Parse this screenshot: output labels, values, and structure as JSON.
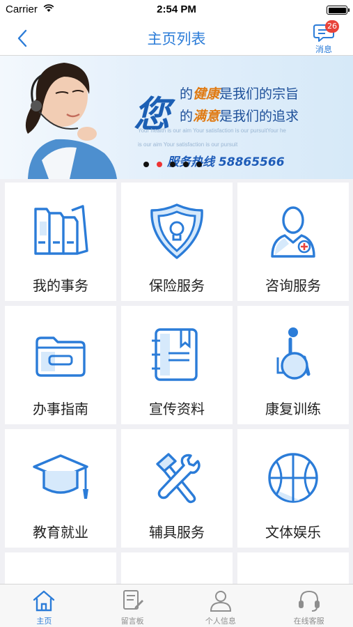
{
  "status_bar": {
    "carrier": "Carrier",
    "time": "2:54 PM"
  },
  "nav": {
    "title": "主页列表",
    "messages_label": "消息",
    "messages_badge": "26"
  },
  "banner": {
    "big_char": "您",
    "line1_a": "的",
    "line1_hl": "健康",
    "line1_b": "是我们的宗旨",
    "line2_a": "的",
    "line2_hl": "满意",
    "line2_b": "是我们的追求",
    "subtitle_1": "Your health is our aim  Your satisfaction is our pursuitYour he",
    "subtitle_2": "is our aim  Your satisfaction is our pursuit",
    "hotline": "服务热线 58865566",
    "active_dot": 1,
    "dot_count": 5
  },
  "menu": [
    {
      "label": "我的事务",
      "icon": "folders-icon"
    },
    {
      "label": "保险服务",
      "icon": "shield-bulb-icon"
    },
    {
      "label": "咨询服务",
      "icon": "doctor-icon"
    },
    {
      "label": "办事指南",
      "icon": "folder-icon"
    },
    {
      "label": "宣传资料",
      "icon": "notebook-icon"
    },
    {
      "label": "康复训练",
      "icon": "wheelchair-icon"
    },
    {
      "label": "教育就业",
      "icon": "graduation-cap-icon"
    },
    {
      "label": "辅具服务",
      "icon": "tools-icon"
    },
    {
      "label": "文体娱乐",
      "icon": "basketball-icon"
    }
  ],
  "tabs": [
    {
      "label": "主页",
      "icon": "home-icon",
      "active": true
    },
    {
      "label": "留言板",
      "icon": "message-board-icon",
      "active": false
    },
    {
      "label": "个人信息",
      "icon": "user-icon",
      "active": false
    },
    {
      "label": "在线客服",
      "icon": "headset-icon",
      "active": false
    }
  ],
  "colors": {
    "accent": "#2b7cd8",
    "badge": "#e8433a",
    "icon_light": "#d6e9fb"
  }
}
